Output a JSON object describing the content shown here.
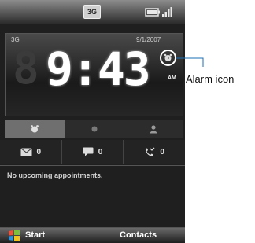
{
  "status_bar": {
    "network_label": "3G"
  },
  "today": {
    "band_label": "3G",
    "date": "9/1/2007",
    "ghost_digit": "8",
    "time": "9:43",
    "ampm": "AM"
  },
  "tabs": [
    {
      "icon": "alarm-icon",
      "active": true
    },
    {
      "icon": "dot-icon",
      "active": false
    },
    {
      "icon": "contact-icon",
      "active": false
    }
  ],
  "notifications": {
    "messages": "0",
    "sms": "0",
    "missed_calls": "0"
  },
  "appointments": {
    "text": "No upcoming appointments."
  },
  "softkeys": {
    "left": "Start",
    "right": "Contacts"
  },
  "callout": {
    "label": "Alarm icon"
  },
  "colors": {
    "callout_line": "#1a6fb5",
    "background": "#1f1f1f"
  }
}
